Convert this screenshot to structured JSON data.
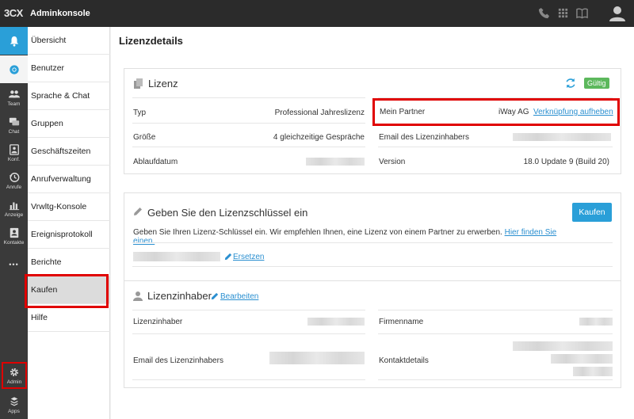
{
  "app": {
    "logo": "3CX",
    "title": "Adminkonsole"
  },
  "rail": {
    "team": "Team",
    "chat": "Chat",
    "konf": "Konf.",
    "anrufe": "Anrufe",
    "anzeige": "Anzeige",
    "kontakte": "Kontakte",
    "more": "•••",
    "admin": "Admin",
    "apps": "Apps"
  },
  "subnav": [
    {
      "label": "Übersicht"
    },
    {
      "label": "Benutzer"
    },
    {
      "label": "Sprache & Chat"
    },
    {
      "label": "Gruppen"
    },
    {
      "label": "Geschäftszeiten"
    },
    {
      "label": "Anrufverwaltung"
    },
    {
      "label": "Vrwltg-Konsole"
    },
    {
      "label": "Ereignisprotokoll"
    },
    {
      "label": "Berichte"
    },
    {
      "label": "Kaufen"
    },
    {
      "label": "Hilfe"
    }
  ],
  "page": {
    "title": "Lizenzdetails"
  },
  "license": {
    "title": "Lizenz",
    "status": "Gültig",
    "rows": {
      "typ_label": "Typ",
      "typ_value": "Professional Jahreslizenz",
      "groesse_label": "Größe",
      "groesse_value": "4 gleichzeitige Gespräche",
      "ablauf_label": "Ablaufdatum",
      "partner_label": "Mein Partner",
      "partner_value": "iWay AG",
      "partner_link": "Verknüpfung aufheben",
      "email_label": "Email des Lizenzinhabers",
      "version_label": "Version",
      "version_value": "18.0 Update 9 (Build 20)"
    }
  },
  "key": {
    "title": "Geben Sie den Lizenzschlüssel ein",
    "buy_button": "Kaufen",
    "description": "Geben Sie Ihren Lizenz-Schlüssel ein. Wir empfehlen Ihnen, eine Lizenz von einem Partner zu erwerben.",
    "find_link": "Hier finden Sie einen.",
    "replace_link": "Ersetzen"
  },
  "holder": {
    "title": "Lizenzinhaber",
    "edit_link": "Bearbeiten",
    "inhaber_label": "Lizenzinhaber",
    "email_label": "Email des Lizenzinhabers",
    "firma_label": "Firmenname",
    "kontakt_label": "Kontaktdetails"
  },
  "colors": {
    "accent": "#2a9fd8",
    "status_green": "#5cb85c",
    "highlight_red": "#e00000"
  }
}
